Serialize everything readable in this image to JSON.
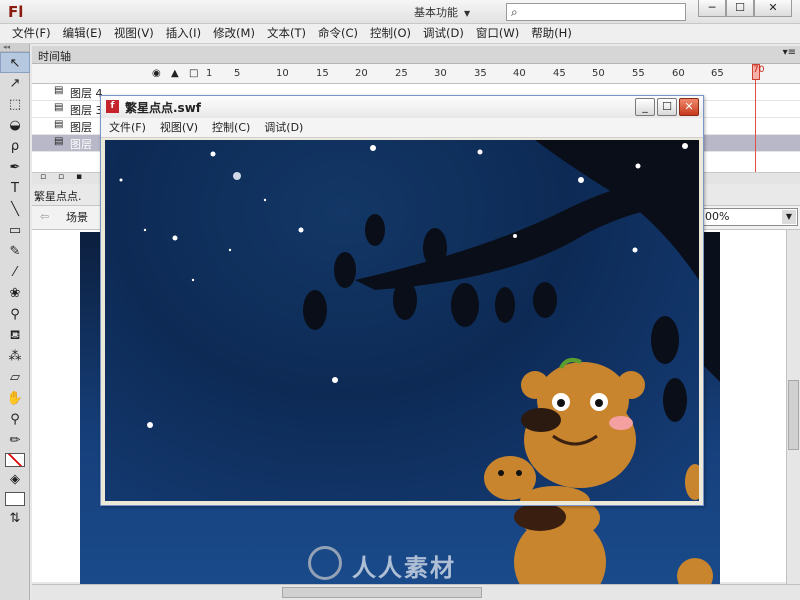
{
  "app": {
    "logo": "Fl",
    "workspace": "基本功能",
    "window_controls": [
      "─",
      "☐",
      "✕"
    ]
  },
  "menubar": [
    "文件(F)",
    "编辑(E)",
    "视图(V)",
    "插入(I)",
    "修改(M)",
    "文本(T)",
    "命令(C)",
    "控制(O)",
    "调试(D)",
    "窗口(W)",
    "帮助(H)"
  ],
  "timeline": {
    "tab": "时间轴",
    "frame_numbers": [
      "1",
      "5",
      "10",
      "15",
      "20",
      "25",
      "30",
      "35",
      "40",
      "45",
      "50",
      "55",
      "60",
      "65",
      "70"
    ],
    "current_frame": "70",
    "layers": [
      {
        "name": "图层 4"
      },
      {
        "name": "图层 3"
      },
      {
        "name": "图层"
      },
      {
        "name": "图层"
      }
    ]
  },
  "document": {
    "tab": "繁星点点.",
    "scene": "场景",
    "zoom": "00%"
  },
  "swf_window": {
    "title": "繁星点点.swf",
    "menu": [
      "文件(F)",
      "视图(V)",
      "控制(C)",
      "调试(D)"
    ]
  },
  "watermark": "人人素材",
  "colors": {
    "sky_top": "#0c1f3e",
    "sky_bottom": "#1a4a8a",
    "playhead": "#e05040",
    "close_button": "#c7391e"
  },
  "icons": [
    "arrow-tool",
    "subselect-tool",
    "free-transform-tool",
    "3d-rotation-tool",
    "lasso-tool",
    "pen-tool",
    "text-tool",
    "line-tool",
    "rectangle-tool",
    "pencil-tool",
    "brush-tool",
    "deco-tool",
    "bone-tool",
    "paint-bucket-tool",
    "eyedropper-tool",
    "eraser-tool",
    "hand-tool",
    "zoom-tool"
  ]
}
